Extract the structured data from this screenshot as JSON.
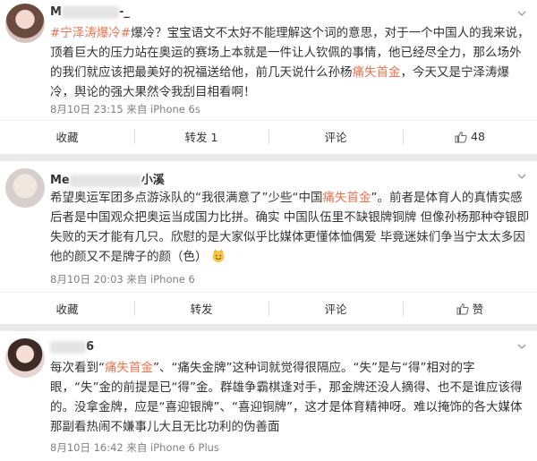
{
  "posts": [
    {
      "username": "M____________-_",
      "username_visible_head": "M",
      "username_visible_tail": "-_",
      "text_topic": "#宁泽涛爆冷#",
      "text_body": "爆冷？宝宝语文不太好不能理解这个词的意思，对于一个中国人的我来说，顶着巨大的压力站在奥运的赛场上本就是一件让人钦佩的事情，他已经尽全力，那么场外的我们就应该把最美好的祝福送给他，前几天说什么孙杨",
      "text_mark": "痛失首金",
      "text_tail": "，今天又是宁泽涛爆冷，舆论的强大果然令我刮目相看啊！",
      "meta": "8月10日 23:15 来自 iPhone 6s",
      "actions": {
        "favorite": "收藏",
        "repost": "转发 1",
        "comment": "评论",
        "like_count": "48"
      }
    },
    {
      "username_visible_head": "Me",
      "username_visible_tail": "小溪",
      "text_part1": "希望奥运军团多点游泳队的“我很满意了”少些“中国",
      "text_mark": "痛失首金",
      "text_part2": "”。前者是体育人的真情实感 后者是中国观众把奥运当成国力比拼。确实 中国队伍里不缺银牌铜牌 但像孙杨那种夺银即失败的天才能有几只。欣慰的是大家似乎比媒体更懂体恤偶爱 毕竟迷妹们争当宁太太多因他的颜又不是牌子的颜（色）",
      "meta": "8月10日 20:03 来自 iPhone 6",
      "actions": {
        "favorite": "收藏",
        "repost": "转发",
        "comment": "评论",
        "like": "赞"
      }
    },
    {
      "username_visible_tail": "6",
      "text_part1": "每次看到“",
      "text_mark": "痛失首金",
      "text_part2": "”、“痛失金牌”这种词就觉得很隔应。“失”是与“得”相对的字眼，“失”金的前提是已“得”金。群雄争霸棋逢对手，那金牌还没人摘得、也不是谁应该得的。没拿金牌，应是“喜迎银牌”、“喜迎铜牌”，这才是体育精神呀。难以掩饰的各大媒体那副看热闹不嫌事儿大且无比功利的伪善面",
      "meta": "8月10日 16:42 来自 iPhone 6 Plus"
    }
  ],
  "icons": [
    "chevron-down-icon",
    "thumb-up-icon",
    "smile-emoji-icon"
  ],
  "colors": {
    "accent": "#eb7350",
    "topic": "#eb7350",
    "meta": "#808080",
    "page_bg": "#eaeaea"
  }
}
